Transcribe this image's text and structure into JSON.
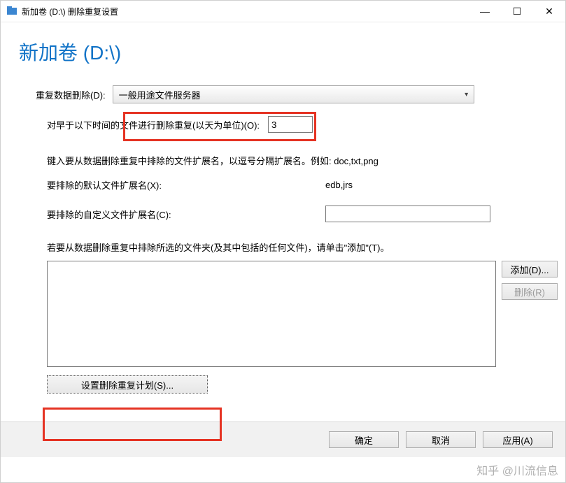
{
  "window": {
    "title": "新加卷 (D:\\) 删除重复设置"
  },
  "heading": "新加卷 (D:\\)",
  "labels": {
    "dedup": "重复数据删除(D):",
    "older_than": "对早于以下时间的文件进行删除重复(以天为单位)(O):",
    "hint_ext": "键入要从数据删除重复中排除的文件扩展名，以逗号分隔扩展名。例如: doc,txt,png",
    "default_ext": "要排除的默认文件扩展名(X):",
    "custom_ext": "要排除的自定义文件扩展名(C):",
    "folder_hint": "若要从数据删除重复中排除所选的文件夹(及其中包括的任何文件)，请单击\"添加\"(T)。"
  },
  "dropdown": {
    "value": "一般用途文件服务器"
  },
  "values": {
    "days": "3",
    "default_ext": "edb,jrs",
    "custom_ext": ""
  },
  "buttons": {
    "add": "添加(D)...",
    "remove": "删除(R)",
    "schedule": "设置删除重复计划(S)...",
    "ok": "确定",
    "cancel": "取消",
    "apply": "应用(A)"
  },
  "watermark": "知乎 @川流信息"
}
